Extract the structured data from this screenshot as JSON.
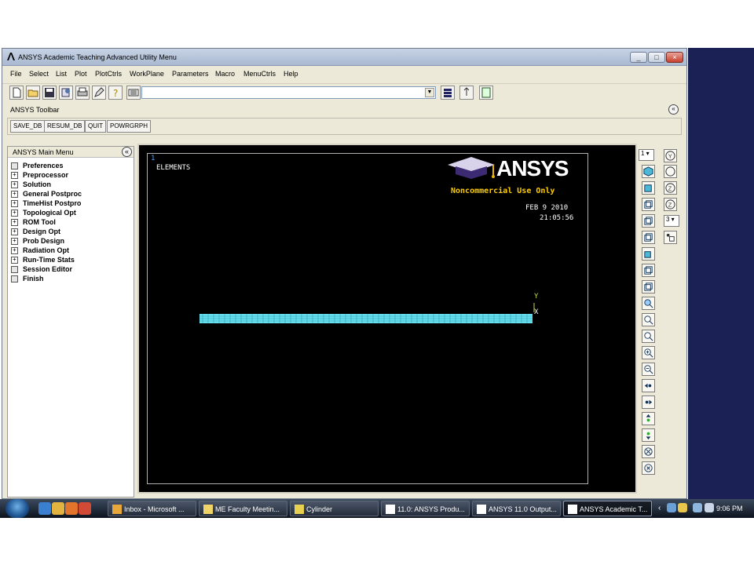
{
  "window": {
    "title": "ANSYS Academic Teaching Advanced Utility Menu",
    "controls": [
      "_",
      "□",
      "×"
    ]
  },
  "menu": [
    "File",
    "Select",
    "List",
    "Plot",
    "PlotCtrls",
    "WorkPlane",
    "Parameters",
    "Macro",
    "MenuCtrls",
    "Help"
  ],
  "toolbar_icons": [
    "new-file-icon",
    "open-folder-icon",
    "save-icon",
    "report-icon",
    "print-icon",
    "pencil-icon",
    "help-query-icon"
  ],
  "command": {
    "value": ""
  },
  "ansys_toolbar": {
    "title": "ANSYS Toolbar",
    "buttons": [
      "SAVE_DB",
      "RESUM_DB",
      "QUIT",
      "POWRGRPH"
    ]
  },
  "main_menu": {
    "title": "ANSYS Main Menu",
    "items": [
      {
        "label": "Preferences",
        "kind": "doc"
      },
      {
        "label": "Preprocessor",
        "kind": "plus"
      },
      {
        "label": "Solution",
        "kind": "plus"
      },
      {
        "label": "General Postproc",
        "kind": "plus"
      },
      {
        "label": "TimeHist Postpro",
        "kind": "plus"
      },
      {
        "label": "Topological Opt",
        "kind": "plus"
      },
      {
        "label": "ROM Tool",
        "kind": "plus"
      },
      {
        "label": "Design Opt",
        "kind": "plus"
      },
      {
        "label": "Prob Design",
        "kind": "plus"
      },
      {
        "label": "Radiation Opt",
        "kind": "plus"
      },
      {
        "label": "Run-Time Stats",
        "kind": "plus"
      },
      {
        "label": "Session Editor",
        "kind": "doc"
      },
      {
        "label": "Finish",
        "kind": "doc"
      }
    ]
  },
  "graphics": {
    "window_number": "1",
    "plot_label": "ELEMENTS",
    "logo_text": "ANSYS",
    "notice": "Noncommercial Use Only",
    "date": "FEB  9 2010",
    "time": "21:05:56",
    "axis_y": "Y",
    "axis_x": "X",
    "colors": {
      "mesh": "#66e0ee",
      "text": "#ffffff",
      "notice": "#ffcc00",
      "axis": "#cfd84a",
      "window_number": "#4aa3ff"
    }
  },
  "view_controls": {
    "window_select": "1",
    "zoom_select": "3"
  },
  "taskbar": {
    "tasks": [
      {
        "label": "Inbox - Microsoft ...",
        "icon": "outlook-icon"
      },
      {
        "label": "ME Faculty Meetin...",
        "icon": "email-icon"
      },
      {
        "label": "Cylinder",
        "icon": "document-icon"
      },
      {
        "label": "11.0: ANSYS Produ...",
        "icon": "ansys-icon"
      },
      {
        "label": "ANSYS 11.0 Output...",
        "icon": "ansys-icon"
      },
      {
        "label": "ANSYS Academic T...",
        "icon": "ansys-icon",
        "active": true
      }
    ],
    "clock": "9:06 PM"
  }
}
